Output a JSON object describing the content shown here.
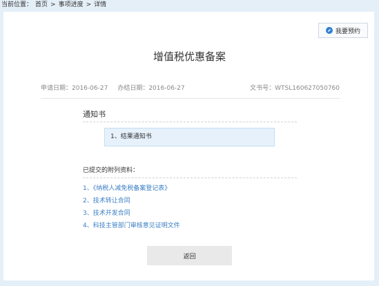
{
  "breadcrumb": {
    "prefix": "当前位置：",
    "items": [
      "首页",
      "事项进度",
      "详情"
    ],
    "separator": ">"
  },
  "actions": {
    "appointment_label": "我要预约",
    "back_label": "返回"
  },
  "page": {
    "title": "增值税优惠备案"
  },
  "meta": {
    "apply_date": "申请日期：2016-06-27",
    "finish_date": "办结日期：2016-06-27",
    "doc_no": "文书号：WTSL160627050760"
  },
  "notice": {
    "section_title": "通知书",
    "items": [
      "1、结果通知书"
    ]
  },
  "attachments": {
    "label": "已提交的附列资料：",
    "items": [
      "1、《纳税人减免税备案登记表》",
      "2、技术转让合同",
      "3、技术开发合同",
      "4、科技主管部门审核意见证明文件"
    ]
  },
  "colors": {
    "background": "#e4eff8",
    "link": "#3a7fc4",
    "accent": "#2f7fd1"
  },
  "icons": {
    "appointment": "pencil-icon"
  }
}
